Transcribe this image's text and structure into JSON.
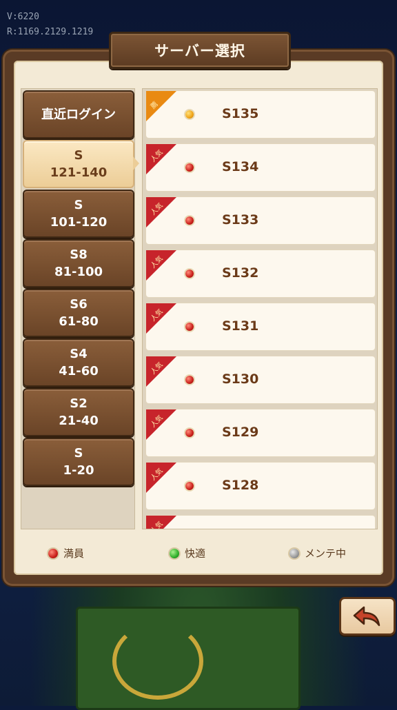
{
  "version": {
    "line1": "V:6220",
    "line2": "R:1169.2129.1219"
  },
  "dialog": {
    "title": "サーバー選択"
  },
  "categories": [
    {
      "line1": "直近ログイン",
      "line2": ""
    },
    {
      "line1": "S",
      "line2": "121-140"
    },
    {
      "line1": "S",
      "line2": "101-120"
    },
    {
      "line1": "S8",
      "line2": "81-100"
    },
    {
      "line1": "S6",
      "line2": "61-80"
    },
    {
      "line1": "S4",
      "line2": "41-60"
    },
    {
      "line1": "S2",
      "line2": "21-40"
    },
    {
      "line1": "S",
      "line2": "1-20"
    }
  ],
  "selected_category": "121-140",
  "servers": [
    {
      "name": "S135",
      "tag": "薦",
      "status": "orange"
    },
    {
      "name": "S134",
      "tag": "人気",
      "status": "red"
    },
    {
      "name": "S133",
      "tag": "人気",
      "status": "red"
    },
    {
      "name": "S132",
      "tag": "人気",
      "status": "red"
    },
    {
      "name": "S131",
      "tag": "人気",
      "status": "red"
    },
    {
      "name": "S130",
      "tag": "人気",
      "status": "red"
    },
    {
      "name": "S129",
      "tag": "人気",
      "status": "red"
    },
    {
      "name": "S128",
      "tag": "人気",
      "status": "red"
    },
    {
      "name": "",
      "tag": "人気",
      "status": "red"
    }
  ],
  "legend": {
    "full": "満員",
    "comfortable": "快適",
    "maintenance": "メンテ中"
  },
  "colors": {
    "panel_frame": "#5a3b25",
    "panel_bg": "#f3ead6",
    "status_full": "#c9201a",
    "status_comfortable": "#2fae2a",
    "status_maintenance": "#9a9a9a",
    "tag_popular": "#c7242b",
    "tag_recommended": "#e98a12"
  }
}
